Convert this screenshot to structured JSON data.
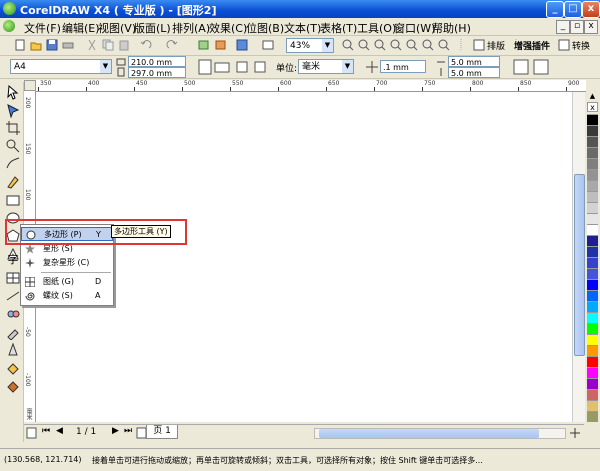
{
  "window": {
    "title": "CorelDRAW X4 ( 专业版 ) - [图形2]",
    "controls": {
      "minimize": "_",
      "maximize": "□",
      "close": "x"
    }
  },
  "menu": {
    "items": [
      "文件(F)",
      "编辑(E)",
      "视图(V)",
      "版面(L)",
      "排列(A)",
      "效果(C)",
      "位图(B)",
      "文本(T)",
      "表格(T)",
      "工具(O)",
      "窗口(W)",
      "帮助(H)"
    ]
  },
  "toolbar": {
    "zoom": "43%",
    "paibian_label": "排版",
    "plugin_label": "增强插件",
    "convert_label": "转换"
  },
  "propbar": {
    "page_size": "A4",
    "width": "210.0 mm",
    "height": "297.0 mm",
    "unit_label": "单位:",
    "unit_value": "毫米",
    "nudge": ".1 mm",
    "dup_x": "5.0 mm",
    "dup_y": "5.0 mm"
  },
  "ruler": {
    "h_ticks": [
      "350",
      "400",
      "450",
      "500",
      "550",
      "600",
      "650",
      "700",
      "750",
      "800",
      "850",
      "900"
    ],
    "v_ticks": [
      "200",
      "150",
      "100",
      "50",
      "0",
      "-50",
      "-100"
    ],
    "unit": "毫米"
  },
  "flyout": {
    "items": [
      {
        "label": "多边形 (P)",
        "key": "Y",
        "icon": "polygon-icon"
      },
      {
        "label": "星形 (S)",
        "key": "",
        "icon": "star-icon"
      },
      {
        "label": "复杂星形 (C)",
        "key": "",
        "icon": "complex-star-icon"
      },
      {
        "label": "图纸 (G)",
        "key": "D",
        "icon": "graph-paper-icon"
      },
      {
        "label": "螺纹 (S)",
        "key": "A",
        "icon": "spiral-icon"
      }
    ],
    "tooltip": "多边形工具 (Y)"
  },
  "pages": {
    "current": "1 / 1",
    "tab": "页 1"
  },
  "status": {
    "coords": "(130.568, 121.714)",
    "message": "接着单击可进行拖动或缩放；再单击可旋转或倾斜；双击工具，可选择所有对象；按住 Shift 键单击可选择多..."
  },
  "colors": {
    "title_bar": "#0a4fd6",
    "highlight": "#e03535",
    "palette": [
      "#000000",
      "#3a3a3a",
      "#555555",
      "#6a6a6a",
      "#7f7f7f",
      "#939393",
      "#a8a8a8",
      "#bdbdbd",
      "#d2d2d2",
      "#e6e6e6",
      "#ffffff",
      "#1f1f8f",
      "#2233aa",
      "#3344cc",
      "#4455dd",
      "#0000ff",
      "#0066ff",
      "#00aaff",
      "#00ffff",
      "#00ff00",
      "#ffff00",
      "#ff9900",
      "#ff0000",
      "#ff00ff",
      "#9900cc",
      "#cc6666",
      "#e0c070",
      "#999966"
    ]
  }
}
